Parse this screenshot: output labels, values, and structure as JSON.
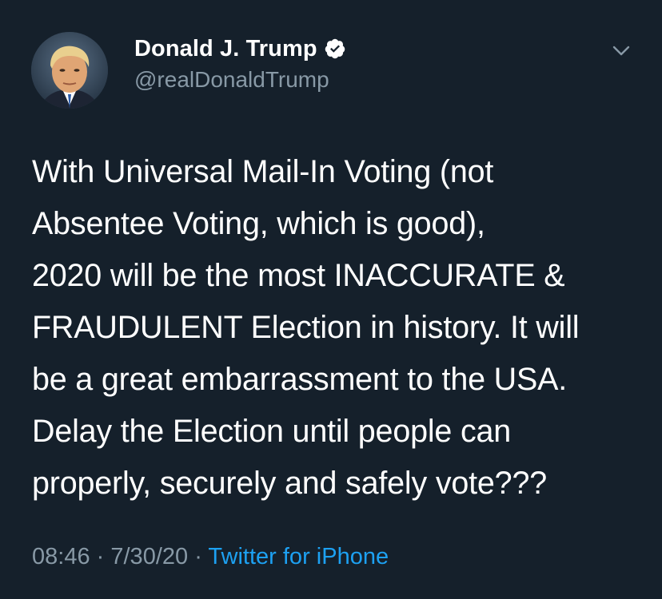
{
  "author": {
    "display_name": "Donald J. Trump",
    "handle": "@realDonaldTrump",
    "verified": true,
    "avatar_icon": "profile-photo",
    "verified_icon": "verified-badge-icon"
  },
  "menu": {
    "icon": "chevron-down-icon"
  },
  "tweet": {
    "text": "With Universal Mail-In Voting (not\nAbsentee Voting, which is good),\n2020 will be the most INACCURATE &\nFRAUDULENT Election in history. It will\nbe a great embarrassment to the USA.\nDelay the Election until people can\nproperly, securely and safely vote???"
  },
  "meta": {
    "time": "08:46",
    "separator": "·",
    "date": "7/30/20",
    "source": "Twitter for iPhone"
  },
  "colors": {
    "background": "#15202b",
    "text": "#ffffff",
    "secondary_text": "#8899a6",
    "link": "#1da1f2"
  }
}
